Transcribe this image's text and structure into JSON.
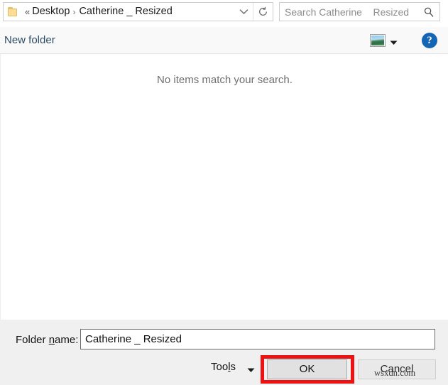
{
  "addressbar": {
    "folder_icon": "folder-icon",
    "overflow_chevron": "«",
    "crumbs": [
      {
        "label": "Desktop",
        "separator": "›"
      },
      {
        "label": "Catherine _ Resized",
        "separator": ""
      }
    ],
    "dropdown_icon": "chevron-down-icon",
    "refresh_icon": "refresh-icon"
  },
  "search": {
    "placeholder": "Search Catherine _ Resized",
    "value": "",
    "icon": "search-icon"
  },
  "toolbar": {
    "new_folder_label": "New folder",
    "view_icon": "picture-view-icon",
    "view_caret_icon": "chevron-down-icon",
    "help_label": "?",
    "help_icon": "help-icon"
  },
  "content": {
    "empty_message": "No items match your search."
  },
  "footer": {
    "folder_name_label_pre": "Folder ",
    "folder_name_label_accel": "n",
    "folder_name_label_post": "ame:",
    "folder_name_value": "Catherine _ Resized",
    "folder_name_placeholder": "Folder name",
    "tools_label_pre": "Too",
    "tools_label_accel": "l",
    "tools_label_post": "s",
    "tools_caret_icon": "chevron-down-icon",
    "ok_label": "OK",
    "cancel_label": "Cancel"
  },
  "watermark": {
    "text": "wsxdn.com"
  },
  "colors": {
    "accent_blue": "#1565b5",
    "highlight_red": "#ee1111",
    "toolbar_bg": "#f9f9f9",
    "footer_bg": "#f0f0f0",
    "link_text": "#2b4a66"
  }
}
